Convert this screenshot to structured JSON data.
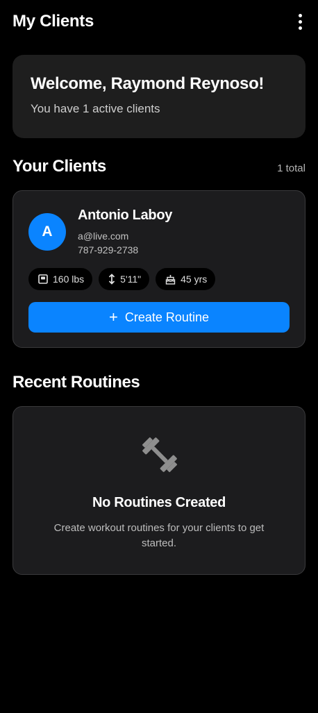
{
  "header": {
    "title": "My Clients",
    "menu_icon": "more-vert-icon"
  },
  "welcome": {
    "title": "Welcome, Raymond Reynoso!",
    "subtitle": "You have 1 active clients"
  },
  "clients_section": {
    "title": "Your Clients",
    "count": "1 total"
  },
  "clients": [
    {
      "initial": "A",
      "name": "Antonio Laboy",
      "email": "a@live.com",
      "phone": "787-929-2738",
      "weight": "160 lbs",
      "height": "5'11\"",
      "age": "45 yrs",
      "create_routine_label": "Create Routine"
    }
  ],
  "routines_section": {
    "title": "Recent Routines",
    "empty_icon": "dumbbell-icon",
    "empty_title": "No Routines Created",
    "empty_desc": "Create workout routines for your clients to get started."
  },
  "colors": {
    "background": "#000000",
    "card": "#1c1c1e",
    "accent": "#0a84ff"
  }
}
